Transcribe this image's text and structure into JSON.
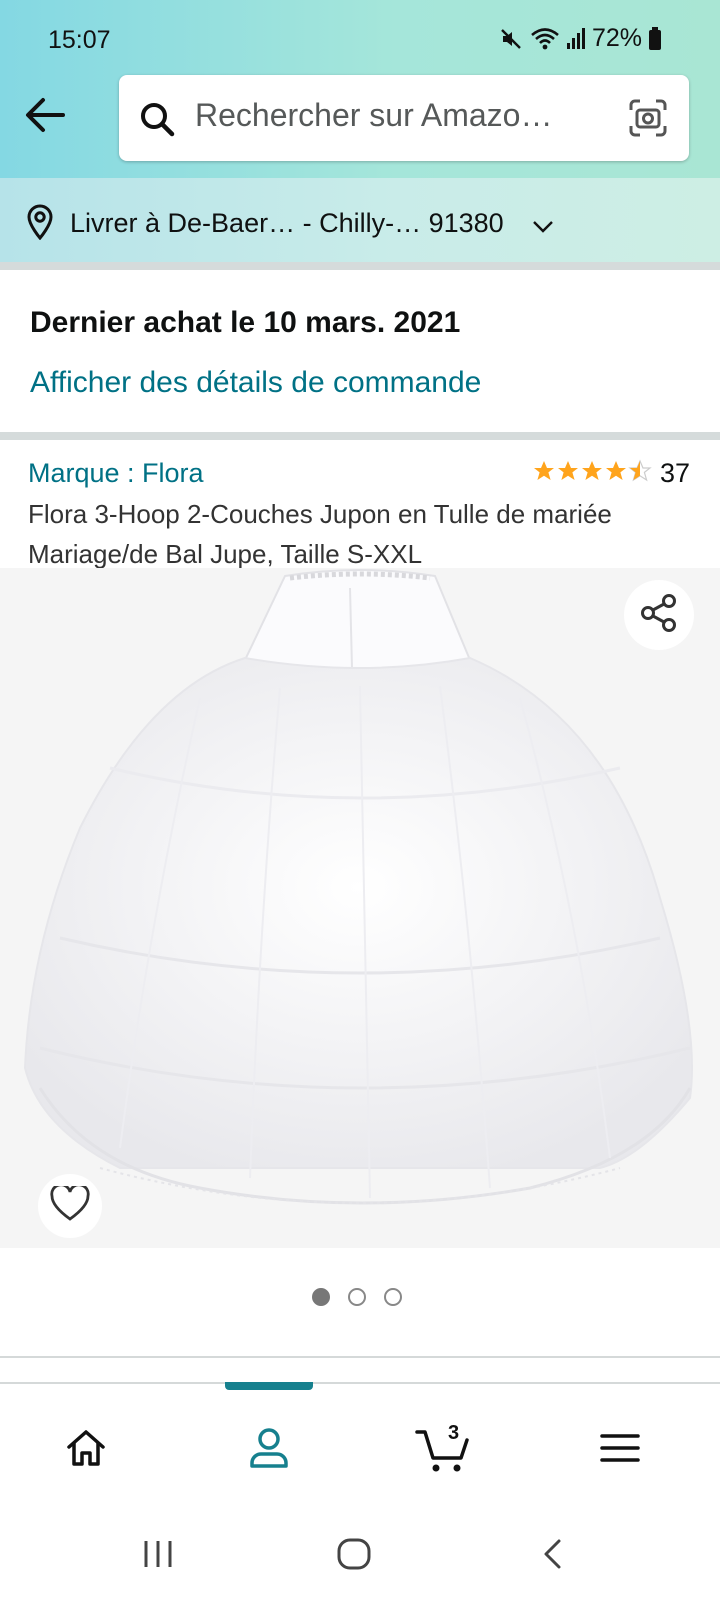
{
  "status_bar": {
    "time": "15:07",
    "battery": "72%",
    "icons": [
      "mute-icon",
      "wifi-icon",
      "signal-icon",
      "battery-icon"
    ]
  },
  "header": {
    "search_placeholder": "Rechercher sur Amazo…",
    "icons": [
      "back-arrow-icon",
      "search-icon",
      "camera-scan-icon"
    ]
  },
  "delivery": {
    "text": "Livrer à De-Baer… - Chilly-… 91380",
    "icons": [
      "location-pin-icon",
      "chevron-down-icon"
    ]
  },
  "order": {
    "title": "Dernier achat le 10 mars. 2021",
    "details_link": "Afficher des détails de commande"
  },
  "product": {
    "brand": "Marque : Flora",
    "rating_stars": 4.5,
    "rating_count": "37",
    "title": "Flora 3-Hoop 2-Couches Jupon en Tulle de mariée Mariage/de Bal Jupe, Taille S-XXL",
    "image_count": 3,
    "active_image": 1,
    "icons": [
      "share-icon",
      "heart-icon",
      "star-icon"
    ]
  },
  "bottom_nav": {
    "cart_count": "3",
    "active": "account",
    "items": [
      "home-icon",
      "account-icon",
      "cart-icon",
      "menu-icon"
    ]
  },
  "colors": {
    "link": "#007185",
    "star": "#ffa41c",
    "nav_accent": "#16808e"
  }
}
